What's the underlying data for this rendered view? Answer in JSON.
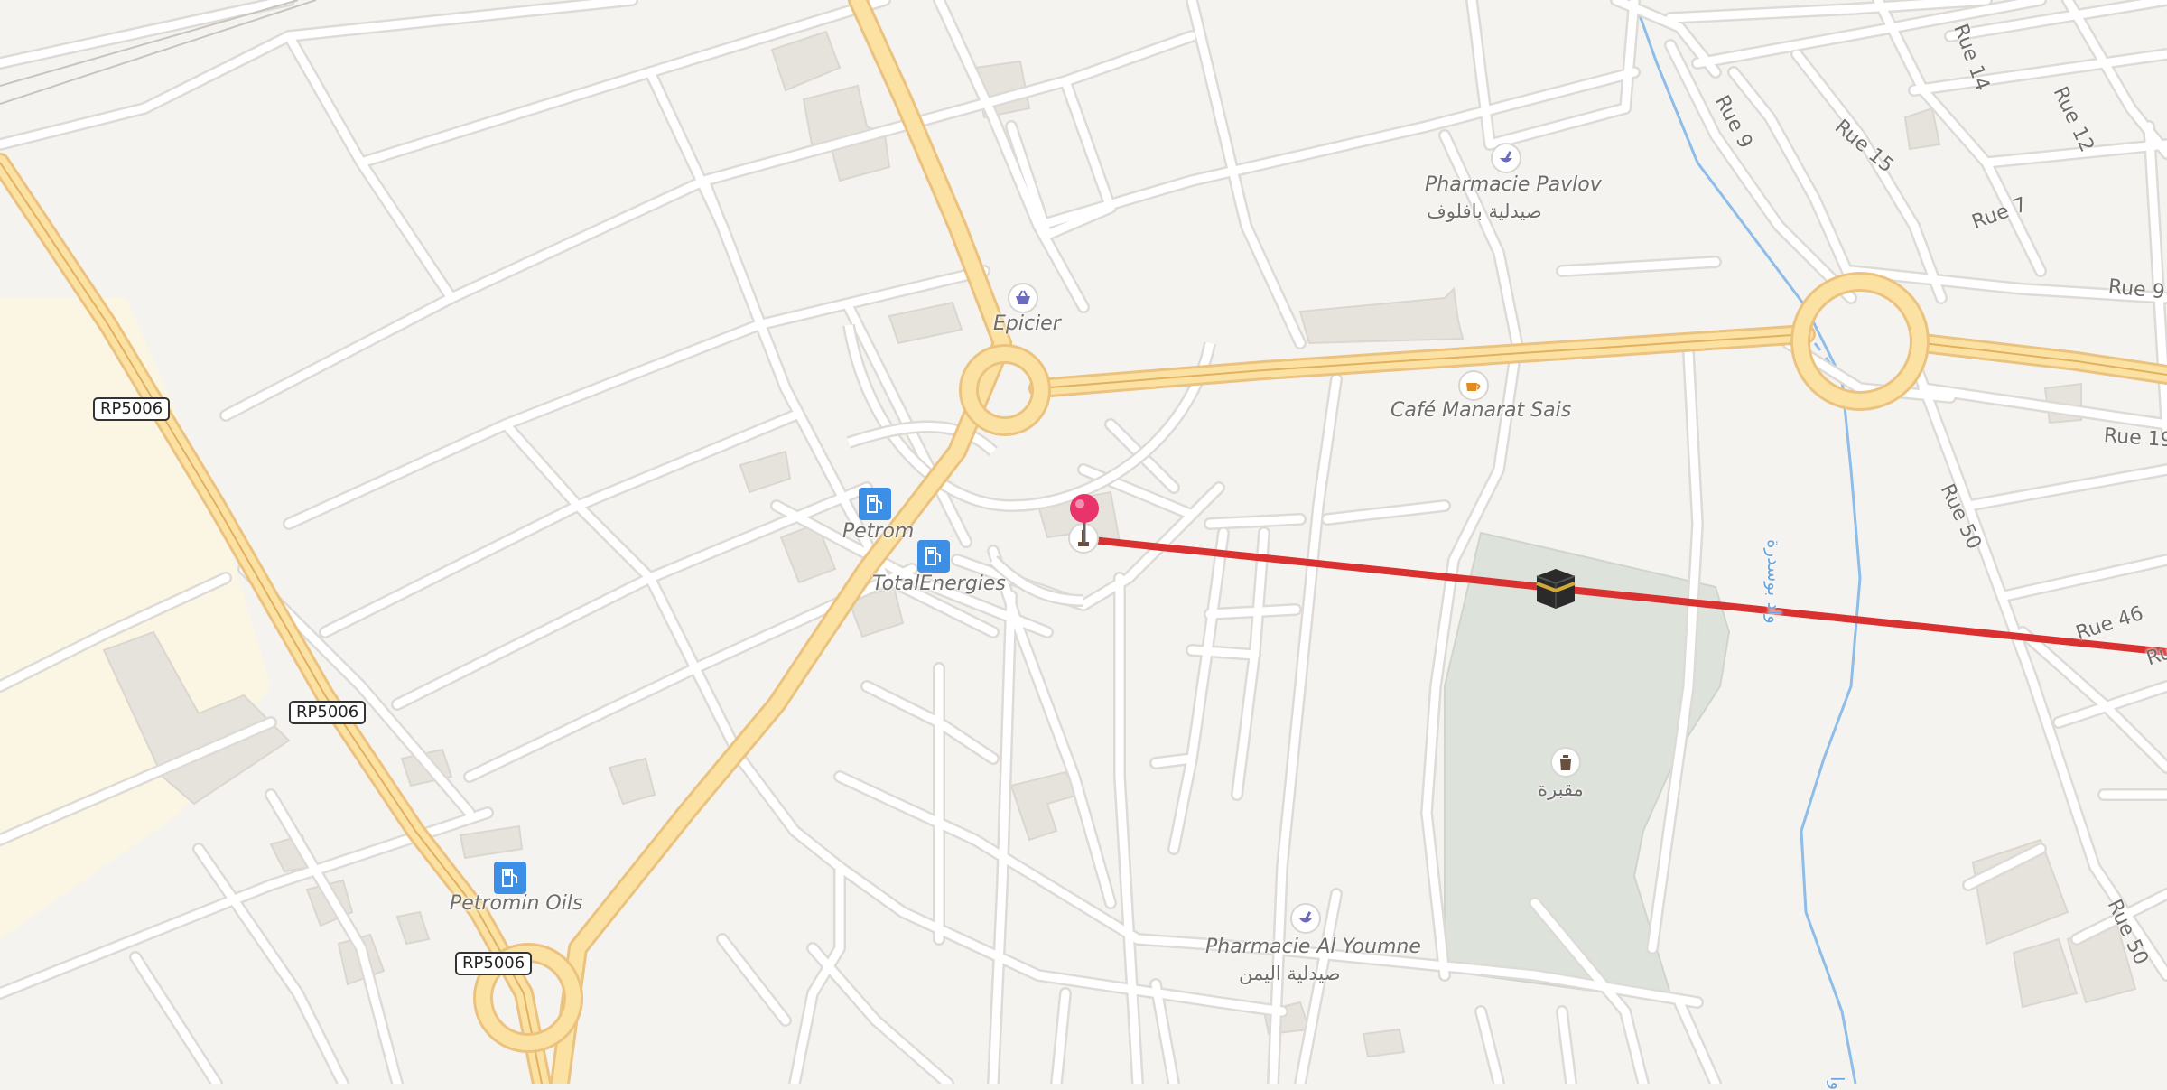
{
  "map": {
    "colors": {
      "background": "#f5f3f0",
      "major_road": "#fbe2a2",
      "major_road_casing": "#ecc27f",
      "minor_road": "#ffffff",
      "minor_road_casing": "#dedbd6",
      "building": "#e8e4df",
      "cemetery": "#dfe4dd",
      "farmland": "#fbf6e3",
      "waterway": "#8dbde8",
      "route_line": "#d93030",
      "pin": "#e8336b"
    },
    "road_shields": [
      {
        "ref": "RP5006"
      },
      {
        "ref": "RP5006"
      },
      {
        "ref": "RP5006"
      }
    ],
    "street_labels": [
      {
        "name": "Rue 9"
      },
      {
        "name": "Rue 14"
      },
      {
        "name": "Rue 12"
      },
      {
        "name": "Rue 15"
      },
      {
        "name": "Rue 7"
      },
      {
        "name": "Rue 9"
      },
      {
        "name": "Rue 19"
      },
      {
        "name": "Rue 50"
      },
      {
        "name": "Rue 46"
      },
      {
        "name": "Rue 50"
      },
      {
        "name": "Rue"
      }
    ],
    "waterway_labels": [
      {
        "name": "واد بوسدرة"
      },
      {
        "name": "وا"
      }
    ],
    "pois": {
      "pharmacie_pavlov": {
        "name": "Pharmacie Pavlov",
        "name_ar": "صيدلية بافلوف",
        "icon": "pharmacy-icon"
      },
      "epicier": {
        "name": "Epicier",
        "icon": "shopping-basket-icon"
      },
      "cafe_manarat_sais": {
        "name": "Café Manarat Sais",
        "icon": "coffee-cup-icon"
      },
      "petrom": {
        "name": "Petrom",
        "icon": "fuel-pump-icon"
      },
      "totalenergies": {
        "name": "TotalEnergies",
        "icon": "fuel-pump-icon"
      },
      "petromin_oils": {
        "name": "Petromin Oils",
        "icon": "fuel-pump-icon"
      },
      "cemetery": {
        "name_ar": "مقبرة",
        "icon": "cemetery-icon"
      },
      "pharmacie_al_youmne": {
        "name": "Pharmacie Al Youmne",
        "name_ar": "صيدلية اليمن",
        "icon": "pharmacy-icon"
      },
      "mosque_marker": {
        "icon": "kaaba-icon"
      },
      "monument_marker": {
        "icon": "monument-icon"
      }
    },
    "route_line": {
      "description_icon": "qibla-direction-line"
    },
    "pin": {
      "icon": "map-pin-icon"
    }
  }
}
